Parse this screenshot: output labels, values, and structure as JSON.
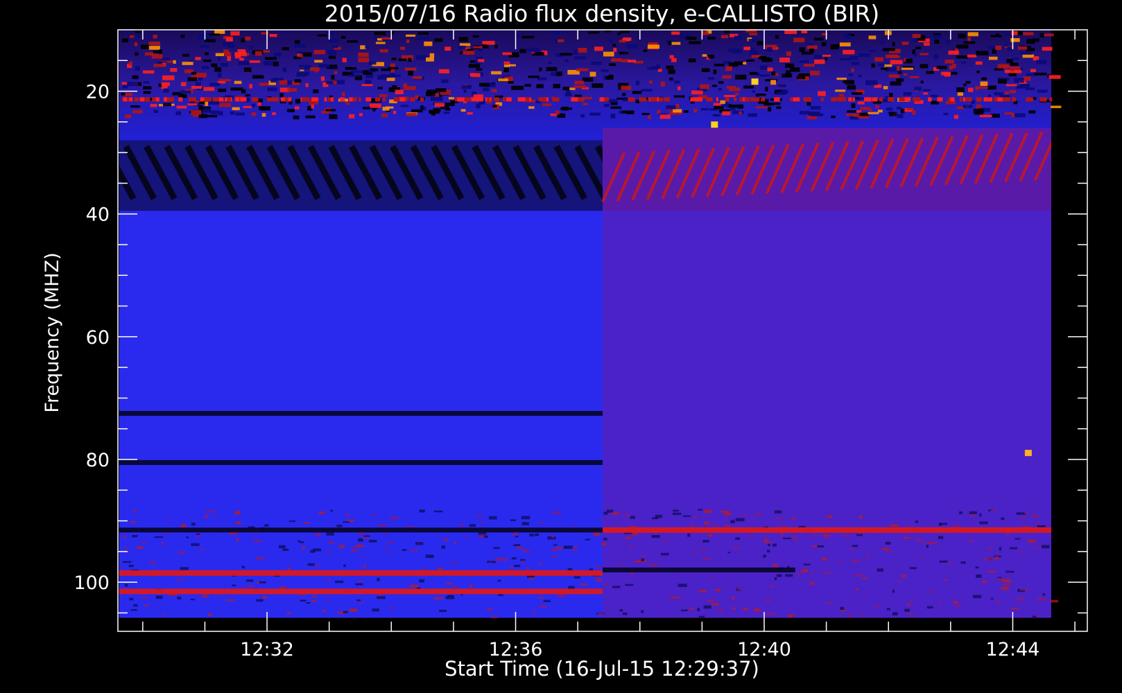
{
  "chart_data": {
    "type": "heatmap",
    "title": "2015/07/16  Radio flux density, e-CALLISTO (BIR)",
    "xlabel": "Start Time (16-Jul-15 12:29:37)",
    "ylabel": "Frequency (MHZ)",
    "x_ticks": [
      "12:32",
      "12:36",
      "12:40",
      "12:44"
    ],
    "y_ticks": [
      "20",
      "40",
      "60",
      "80",
      "100"
    ],
    "x_tick_minutes": [
      32,
      36,
      40,
      44
    ],
    "y_tick_values": [
      20,
      40,
      60,
      80,
      100
    ],
    "xlim_minutes_after_12h": [
      29.6,
      45.2
    ],
    "data_xlim_minutes_after_12h": [
      29.62,
      44.62
    ],
    "ylim_mhz": [
      108,
      10
    ],
    "data_ylim_mhz": [
      10,
      105.8
    ],
    "minor_tick_step_mhz": 5,
    "minor_tick_step_minutes": 1,
    "colormap": [
      "#000000",
      "#0a0a7a",
      "#1f1fee",
      "#4040ff",
      "#7a1a9a",
      "#b01515",
      "#ff2020",
      "#ff9000",
      "#ffd020"
    ],
    "background_change_minute": 37.4,
    "features": [
      {
        "kind": "bright band",
        "freq_mhz": 98.5,
        "from_min": 29.62,
        "to_min": 37.4
      },
      {
        "kind": "bright band",
        "freq_mhz": 101.5,
        "from_min": 29.62,
        "to_min": 37.4
      },
      {
        "kind": "dark band",
        "freq_mhz": 91.5,
        "from_min": 29.62,
        "to_min": 37.4
      },
      {
        "kind": "bright band",
        "freq_mhz": 91.5,
        "from_min": 37.4,
        "to_min": 44.62
      },
      {
        "kind": "dark band",
        "freq_mhz": 98,
        "from_min": 37.4,
        "to_min": 40.5
      },
      {
        "kind": "dark band",
        "freq_mhz": 72.5,
        "from_min": 29.62,
        "to_min": 37.4
      },
      {
        "kind": "dark band",
        "freq_mhz": 80.5,
        "from_min": 29.62,
        "to_min": 37.4
      },
      {
        "kind": "dark striations",
        "freq_range_mhz": [
          29,
          39
        ],
        "from_min": 29.62,
        "to_min": 37.4
      },
      {
        "kind": "red striations",
        "freq_range_mhz": [
          26,
          38
        ],
        "from_min": 37.4,
        "to_min": 44.62
      },
      {
        "kind": "hot spot",
        "freq_mhz": 79,
        "minute": 44.25,
        "color": "#ffb020"
      },
      {
        "kind": "hot spot",
        "freq_mhz": 25.5,
        "minute": 39.2,
        "color": "#ffd020"
      },
      {
        "kind": "hot spot",
        "freq_mhz": 18.5,
        "minute": 39.85,
        "color": "#ffd020"
      }
    ]
  }
}
